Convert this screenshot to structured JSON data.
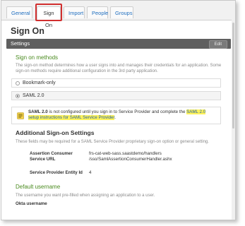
{
  "tabs": [
    "General",
    "Sign On",
    "Import",
    "People",
    "Groups"
  ],
  "page_title": "Sign On",
  "settings": {
    "title": "Settings",
    "edit_label": "Edit"
  },
  "sign_on_methods": {
    "heading": "Sign on methods",
    "description": "The sign-on method determines how a user signs into and manages their credentials for an application. Some sign-on methods require additional configuration in the 3rd party application.",
    "options": [
      {
        "label": "Bookmark-only",
        "selected": false
      },
      {
        "label": "SAML 2.0",
        "selected": true
      }
    ],
    "warning": {
      "strong": "SAML 2.0",
      "text": " is not configured until you sign in to Service Provider and complete the ",
      "link": "SAML 2.0 setup instructions for SAML Service Provider",
      "end": "."
    }
  },
  "additional": {
    "heading": "Additional Sign-on Settings",
    "description": "These fields may be required for a SAML Service Provider proprietary sign-on option or general setting.",
    "fields": [
      {
        "label": "Assertion Consumer Service URL",
        "value": "frs-cat-web-sass.saastdemo/handlers /sso/SamlAssertionConsumerHandler.ashx"
      },
      {
        "label": "Service Provider Entity Id",
        "value": "4"
      }
    ]
  },
  "default_username": {
    "heading": "Default username",
    "description": "The username you want pre-filled when assigning an application to a user.",
    "field_label": "Okta username"
  },
  "colors": {
    "accent_green": "#4a8b1f",
    "link_blue": "#1f6ebf",
    "highlight": "#fff35a",
    "callout_red": "#d12f2f"
  }
}
